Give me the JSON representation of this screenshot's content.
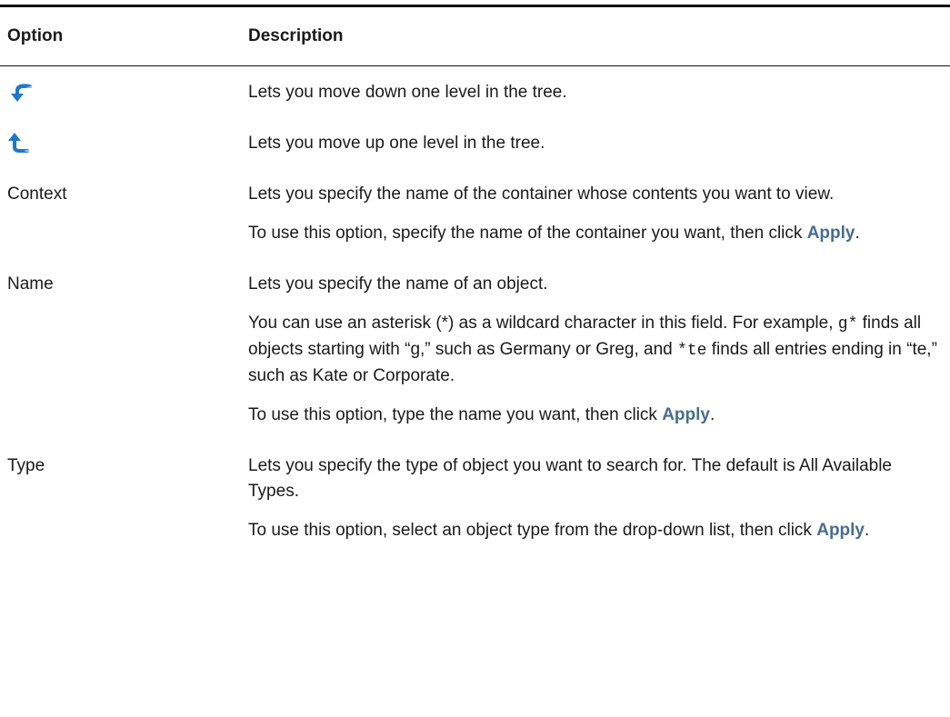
{
  "headers": {
    "option": "Option",
    "description": "Description"
  },
  "rows": [
    {
      "option_icon": "arrow-down-level-icon",
      "desc": [
        "Lets you move down one level in the tree."
      ]
    },
    {
      "option_icon": "arrow-up-level-icon",
      "desc": [
        "Lets you move up one level in the tree."
      ]
    },
    {
      "option": "Context",
      "desc": [
        "Lets you specify the name of the container whose contents you want to view.",
        {
          "before": "To use this option, specify the name of the container you want, then click ",
          "apply": "Apply",
          "after": "."
        }
      ]
    },
    {
      "option": "Name",
      "desc": [
        "Lets you specify the name of an object.",
        {
          "t1": "You can use an asterisk (*) as a wildcard character in this field. For example, ",
          "code1": "g*",
          "t2": " finds all objects starting with “g,” such as Germany or Greg, and ",
          "code2": "*te",
          "t3": " finds all entries ending in “te,” such as Kate or Corporate."
        },
        {
          "before": "To use this option, type the name you want, then click ",
          "apply": "Apply",
          "after": "."
        }
      ]
    },
    {
      "option": "Type",
      "desc": [
        "Lets you specify the type of object you want to search for. The default is All Available Types.",
        {
          "before": "To use this option, select an object type from the drop-down list, then click ",
          "apply": "Apply",
          "after": "."
        }
      ]
    }
  ],
  "colors": {
    "apply_link": "#4a6d8c",
    "icon_blue": "#1e78c8",
    "rule": "#111111"
  }
}
